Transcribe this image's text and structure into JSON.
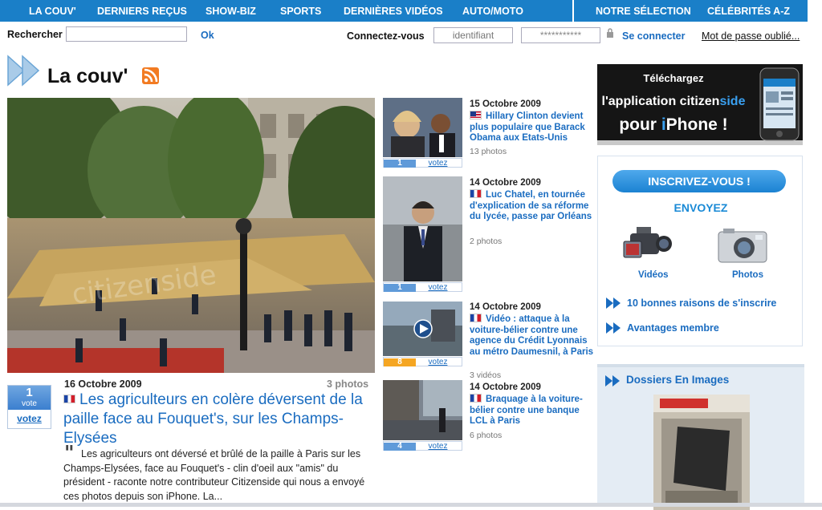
{
  "nav": {
    "items": [
      "LA COUV'",
      "DERNIERS REÇUS",
      "SHOW-BIZ",
      "SPORTS",
      "DERNIÈRES VIDÉOS",
      "AUTO/MOTO"
    ],
    "right_items": [
      "NOTRE SÉLECTION",
      "CÉLÉBRITÉS A-Z"
    ]
  },
  "search": {
    "label": "Rechercher",
    "value": "",
    "button": "Ok"
  },
  "login": {
    "label": "Connectez-vous",
    "id_placeholder": "identifiant",
    "pw_value": "***********",
    "connect": "Se connecter",
    "forgot": "Mot de passe oublié..."
  },
  "page": {
    "title": "La couv'"
  },
  "hero": {
    "date": "16 Octobre 2009",
    "photos": "3 photos",
    "votes": "1",
    "vote_word": "vote",
    "vote_link": "votez",
    "headline": "Les agriculteurs en colère déversent de la paille face au Fouquet's, sur les Champs-Elysées",
    "summary": "Les agriculteurs ont déversé et brûlé de la paille à Paris sur les Champs-Elysées, face au Fouquet's - clin d'oeil aux \"amis\" du président - raconte notre contributeur Citizenside qui nous a envoyé ces photos depuis son iPhone. La..."
  },
  "stories": [
    {
      "date": "15 Octobre 2009",
      "flag": "us",
      "title": "Hillary Clinton devient plus populaire que Barack Obama aux Etats-Unis",
      "count": "13 photos",
      "votes": "1",
      "vote_link": "votez"
    },
    {
      "date": "14 Octobre 2009",
      "flag": "fr",
      "title": "Luc Chatel, en tournée d'explication de sa réforme du lycée, passe par Orléans",
      "count": "2 photos",
      "votes": "1",
      "vote_link": "votez"
    },
    {
      "date": "14 Octobre 2009",
      "flag": "fr",
      "title": "Vidéo : attaque à la voiture-bélier contre une agence du Crédit Lyonnais au métro Daumesnil, à Paris",
      "count": "3 vidéos",
      "votes": "8",
      "vote_link": "votez"
    },
    {
      "date": "14 Octobre 2009",
      "flag": "fr",
      "title": "Braquage à la voiture-bélier contre une banque LCL à Paris",
      "count": "6 photos",
      "votes": "4",
      "vote_link": "votez"
    }
  ],
  "ad": {
    "line1": "Téléchargez",
    "line2a": "l'application citizen",
    "line2b": "side",
    "line3a": "pour ",
    "line3b": "i",
    "line3c": "Phone !"
  },
  "signup": {
    "button": "INSCRIVEZ-VOUS !",
    "heading": "ENVOYEZ",
    "videos": "Vidéos",
    "photos": "Photos",
    "link1": "10 bonnes raisons de s'inscrire",
    "link2": "Avantages membre"
  },
  "dossiers": {
    "heading": "Dossiers En Images"
  },
  "colors": {
    "brand": "#1a7fc8",
    "link": "#1a6cc0",
    "accent_orange": "#f27b22"
  }
}
